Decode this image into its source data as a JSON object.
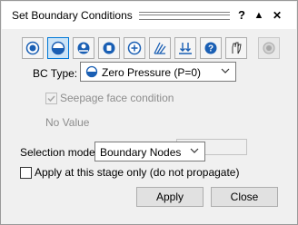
{
  "dialog": {
    "title": "Set Boundary Conditions",
    "help_label": "?",
    "collapse_label": "▲",
    "close_label": "✕"
  },
  "toolbar": {
    "items": [
      {
        "icon": "radio-filled-icon"
      },
      {
        "icon": "zero-pressure-icon"
      },
      {
        "icon": "pressure-head-icon"
      },
      {
        "icon": "total-head-icon"
      },
      {
        "icon": "unknown-icon"
      },
      {
        "icon": "infiltration-icon"
      },
      {
        "icon": "flux-icon"
      },
      {
        "icon": "help-circle-icon"
      },
      {
        "icon": "seepage-glove-icon"
      },
      {
        "icon": "disabled-dot-icon"
      }
    ]
  },
  "bc_type": {
    "label": "BC Type:",
    "value": "Zero Pressure (P=0)"
  },
  "seepage": {
    "label": "Seepage face condition",
    "checked": true,
    "disabled": true
  },
  "no_value": {
    "label": "No Value",
    "value": ""
  },
  "selection_mode": {
    "label": "Selection mode:",
    "value": "Boundary Nodes"
  },
  "apply_stage": {
    "label": "Apply at this stage only (do not propagate)",
    "checked": false
  },
  "buttons": {
    "apply": "Apply",
    "close": "Close"
  },
  "colors": {
    "accent": "#0078d7",
    "icon_blue": "#1a5fb4",
    "disabled_text": "#8d8d8d"
  }
}
